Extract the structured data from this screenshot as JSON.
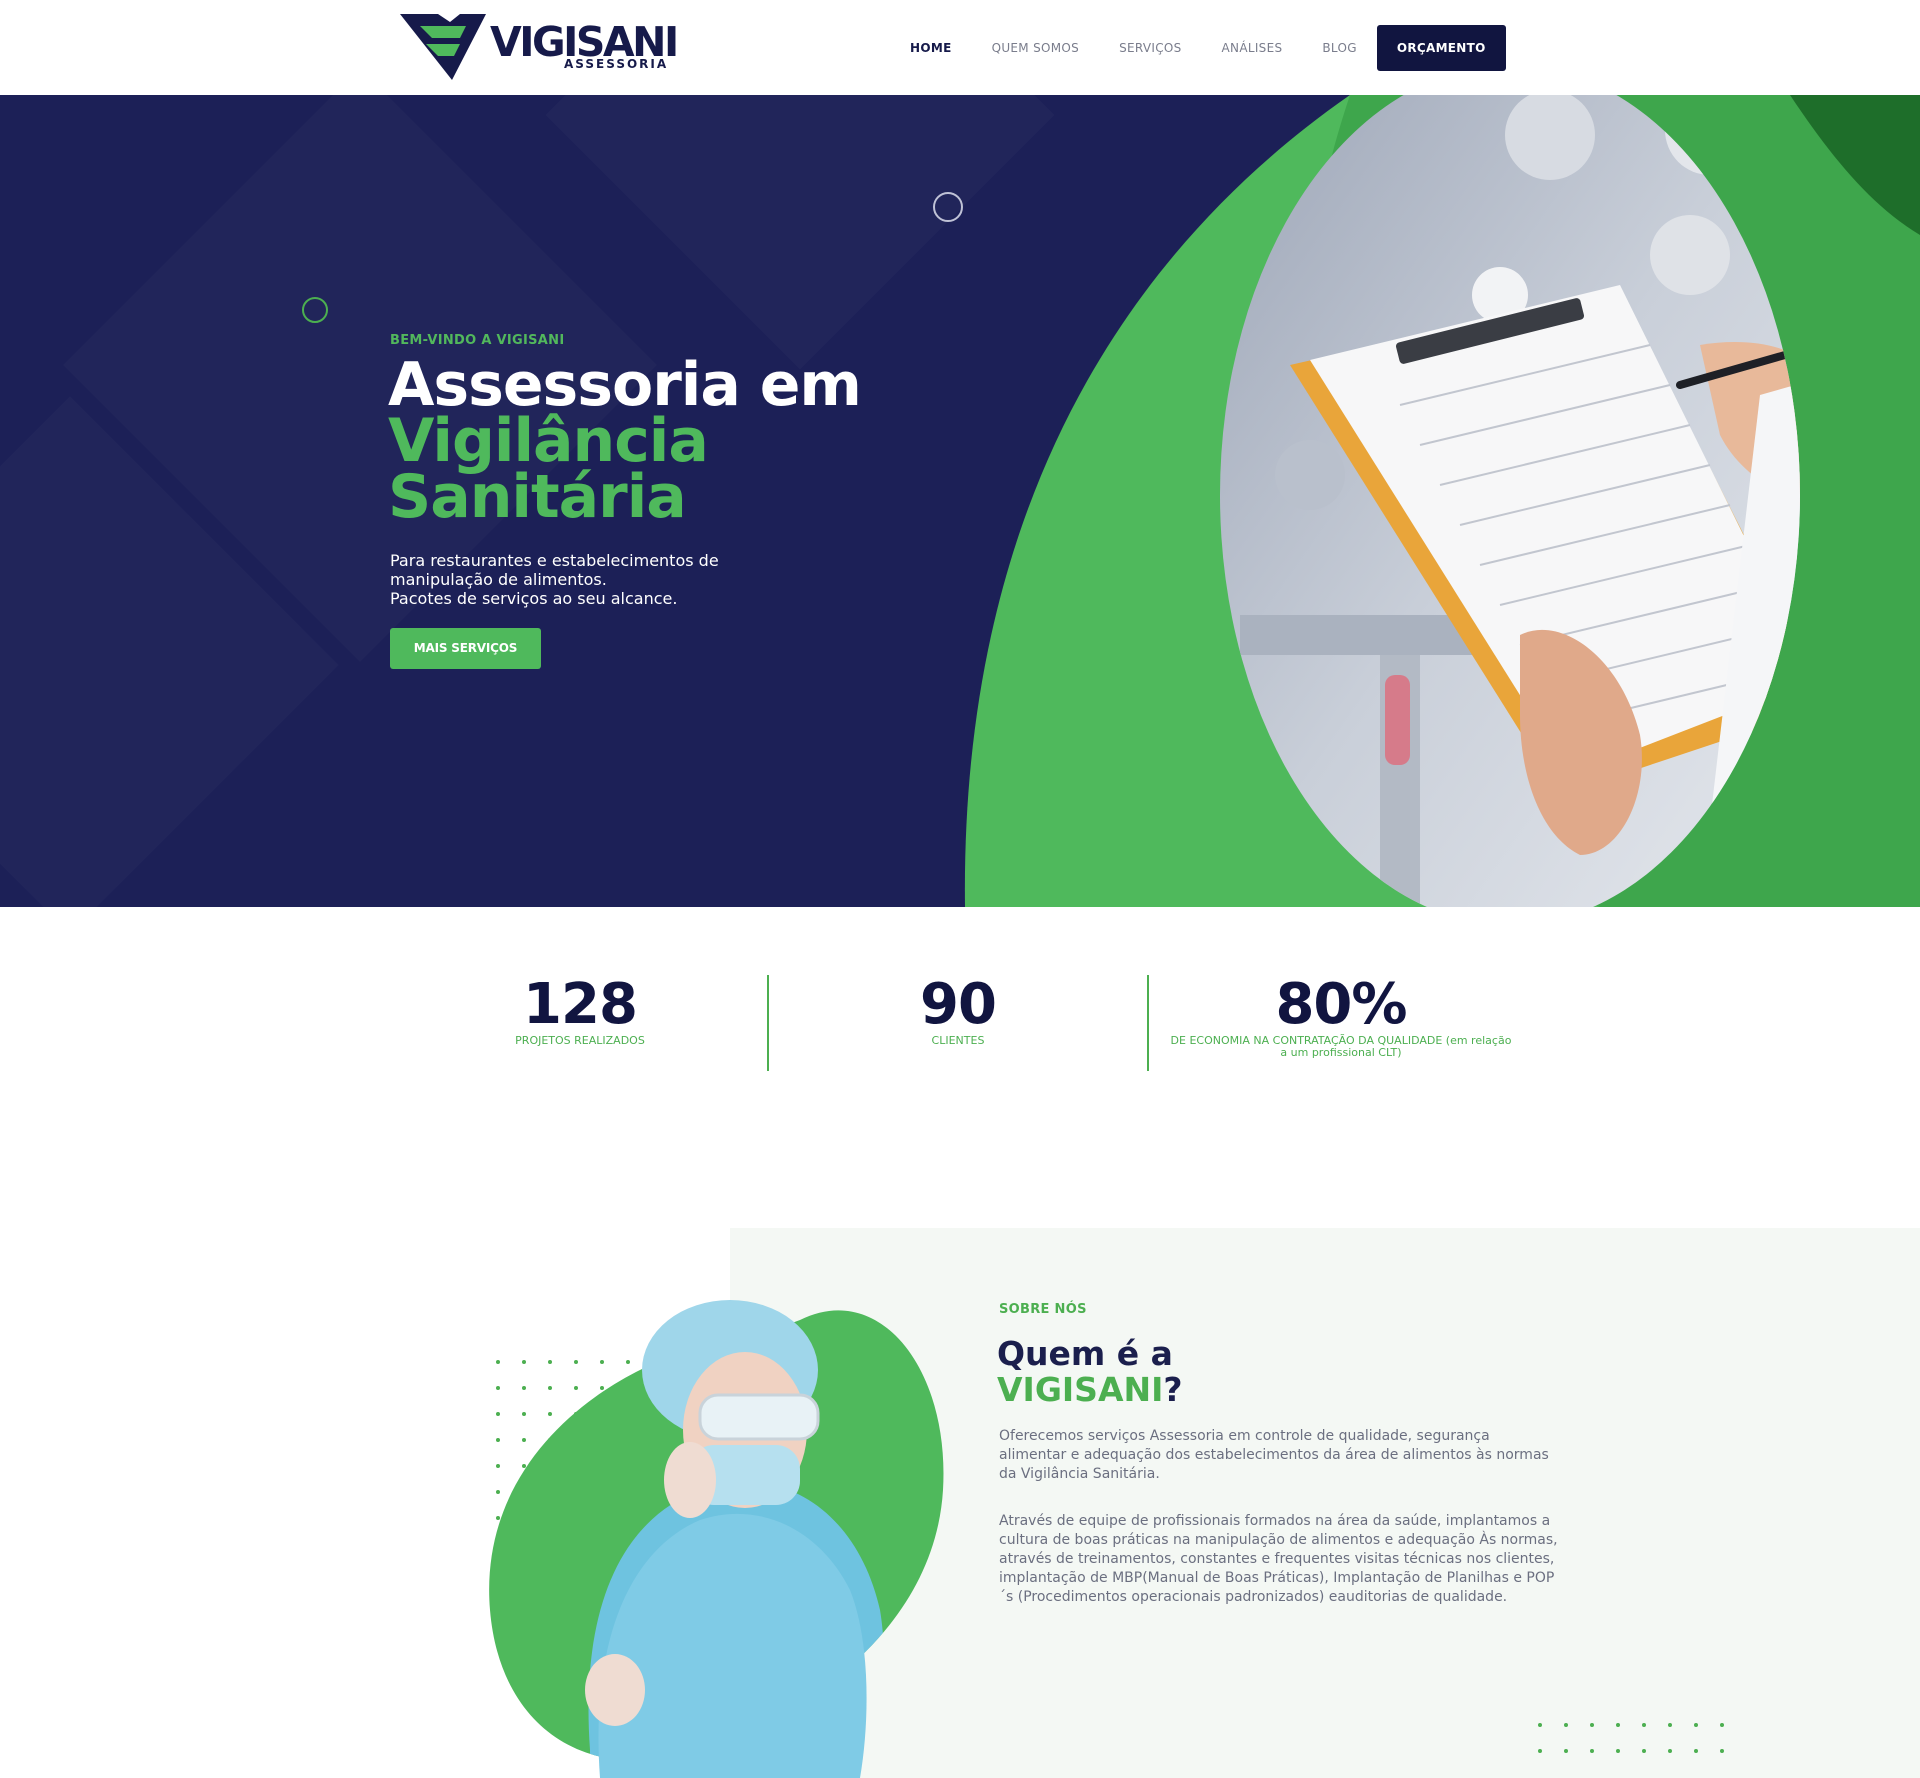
{
  "brand": {
    "name": "VIGISANI",
    "tagline": "ASSESSORIA",
    "colors": {
      "navy": "#1c2057",
      "green": "#4fb95c",
      "dark": "#111540"
    }
  },
  "nav": {
    "items": [
      "HOME",
      "QUEM SOMOS",
      "SERVIÇOS",
      "ANÁLISES",
      "BLOG"
    ],
    "cta": "ORÇAMENTO",
    "active": "HOME"
  },
  "hero": {
    "eyebrow": "BEM-VINDO A VIGISANI",
    "title_line1": "Assessoria em",
    "title_line2": "Vigilância",
    "title_line3": "Sanitária",
    "subtitle_line1": "Para restaurantes e estabelecimentos de",
    "subtitle_line2": "manipulação de alimentos.",
    "subtitle_line3": "Pacotes de serviços ao seu alcance.",
    "button": "MAIS SERVIÇOS"
  },
  "stats": [
    {
      "value": "128",
      "label": "PROJETOS REALIZADOS"
    },
    {
      "value": "90",
      "label": "CLIENTES"
    },
    {
      "value": "80%",
      "label_line1": "DE ECONOMIA NA CONTRATAÇÃO DA QUALIDADE (em relação",
      "label_line2": "a um profissional CLT)"
    }
  ],
  "about": {
    "eyebrow": "SOBRE NÓS",
    "title_line1": "Quem é a",
    "title_brand": "VIGISANI",
    "title_suffix": "?",
    "paragraph1": "Oferecemos serviços Assessoria em controle de qualidade, segurança alimentar e adequação dos estabelecimentos da área de alimentos às normas da Vigilância Sanitária.",
    "paragraph2": "Através de equipe de profissionais formados na área da saúde, implantamos a cultura de boas práticas na manipulação de alimentos e adequação Às normas, através de treinamentos, constantes e frequentes visitas técnicas nos clientes, implantação de MBP(Manual de Boas Práticas), Implantação de Planilhas e POP´s (Procedimentos operacionais padronizados) eauditorias de qualidade."
  }
}
